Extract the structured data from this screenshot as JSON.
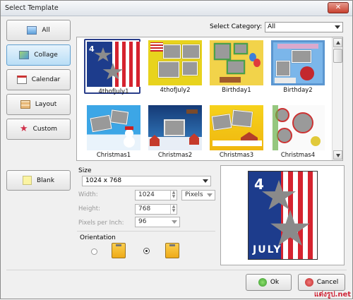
{
  "window": {
    "title": "Select Template",
    "close_glyph": "✕"
  },
  "sidebar": {
    "items": [
      {
        "label": "All",
        "icon": "all-icon"
      },
      {
        "label": "Collage",
        "icon": "collage-icon",
        "selected": true
      },
      {
        "label": "Calendar",
        "icon": "calendar-icon"
      },
      {
        "label": "Layout",
        "icon": "layout-icon"
      },
      {
        "label": "Custom",
        "icon": "star-icon"
      },
      {
        "label": "Blank",
        "icon": "blank-icon"
      }
    ]
  },
  "category": {
    "label": "Select Category:",
    "value": "All"
  },
  "templates": [
    {
      "name": "4thofJuly1",
      "selected": true
    },
    {
      "name": "4thofJuly2"
    },
    {
      "name": "Birthday1"
    },
    {
      "name": "Birthday2"
    },
    {
      "name": "Christmas1"
    },
    {
      "name": "Christmas2"
    },
    {
      "name": "Christmas3"
    },
    {
      "name": "Christmas4"
    }
  ],
  "size": {
    "label": "Size",
    "preset": "1024 x 768",
    "width_label": "Width:",
    "width": "1024",
    "unit": "Pixels",
    "height_label": "Height:",
    "height": "768",
    "ppi_label": "Pixels per Inch:",
    "ppi": "96",
    "orientation_label": "Orientation",
    "orientation": "landscape"
  },
  "buttons": {
    "ok": "Ok",
    "cancel": "Cancel"
  },
  "watermark": "แต่งรูป.net",
  "colors": {
    "selected_border": "#2a3e8a",
    "accent": "#5f9fd0"
  }
}
